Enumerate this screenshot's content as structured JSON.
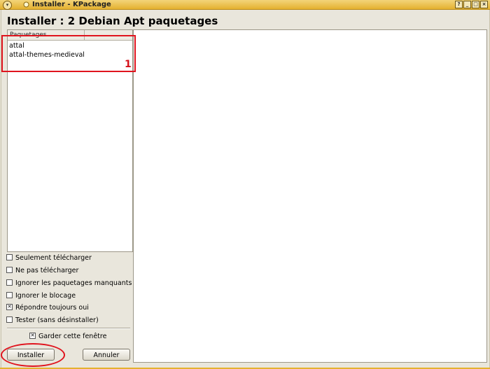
{
  "window": {
    "title": "Installer - KPackage",
    "controls": [
      "?",
      "_",
      "□",
      "×"
    ]
  },
  "heading": "Installer : 2 Debian Apt paquetages",
  "package_list": {
    "column_header": "Paquetages",
    "items": [
      "attal",
      "attal-themes-medieval"
    ]
  },
  "options": [
    {
      "label": "Seulement télécharger",
      "checked": false
    },
    {
      "label": "Ne pas télécharger",
      "checked": false
    },
    {
      "label": "Ignorer les paquetages manquants",
      "checked": false
    },
    {
      "label": "Ignorer le blocage",
      "checked": false
    },
    {
      "label": "Répondre toujours oui",
      "checked": true
    },
    {
      "label": "Tester (sans désinstaller)",
      "checked": false
    }
  ],
  "keep_window": {
    "label": "Garder cette fenêtre",
    "checked": true
  },
  "buttons": {
    "install": "Installer",
    "cancel": "Annuler"
  },
  "annotation": {
    "number": "1",
    "color": "#e0141e"
  },
  "colors": {
    "titlebar": "#e4b12f"
  }
}
